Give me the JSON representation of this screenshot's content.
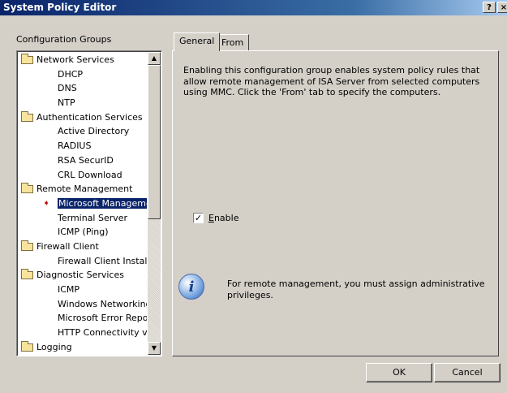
{
  "window": {
    "title": "System Policy Editor",
    "help_label": "?",
    "close_label": "×"
  },
  "groups": {
    "label": "Configuration Groups",
    "items": [
      {
        "type": "group",
        "label": "Network Services"
      },
      {
        "type": "child",
        "label": "DHCP"
      },
      {
        "type": "child",
        "label": "DNS"
      },
      {
        "type": "child",
        "label": "NTP"
      },
      {
        "type": "group",
        "label": "Authentication Services"
      },
      {
        "type": "child",
        "label": "Active Directory"
      },
      {
        "type": "child",
        "label": "RADIUS"
      },
      {
        "type": "child",
        "label": "RSA SecurID"
      },
      {
        "type": "child",
        "label": "CRL Download"
      },
      {
        "type": "group",
        "label": "Remote Management"
      },
      {
        "type": "child",
        "label": "Microsoft Manageme",
        "selected": true
      },
      {
        "type": "child",
        "label": "Terminal Server"
      },
      {
        "type": "child",
        "label": "ICMP (Ping)"
      },
      {
        "type": "group",
        "label": "Firewall Client"
      },
      {
        "type": "child",
        "label": "Firewall Client Install"
      },
      {
        "type": "group",
        "label": "Diagnostic Services"
      },
      {
        "type": "child",
        "label": "ICMP"
      },
      {
        "type": "child",
        "label": "Windows Networking"
      },
      {
        "type": "child",
        "label": "Microsoft Error Repo"
      },
      {
        "type": "child",
        "label": "HTTP Connectivity ve"
      },
      {
        "type": "group",
        "label": "Logging"
      }
    ]
  },
  "tabs": {
    "general": "General",
    "from": "From"
  },
  "general": {
    "description": "Enabling this configuration group enables system policy rules that allow remote management of ISA Server from selected computers using MMC. Click the 'From' tab to specify the computers.",
    "enable_label": "Enable",
    "enable_checked": true,
    "info_text": "For remote management, you must assign administrative privileges."
  },
  "buttons": {
    "ok": "OK",
    "cancel": "Cancel"
  },
  "icons": {
    "folder": "folder-icon",
    "arrow": "red-arrow-icon",
    "info": "info-icon"
  }
}
